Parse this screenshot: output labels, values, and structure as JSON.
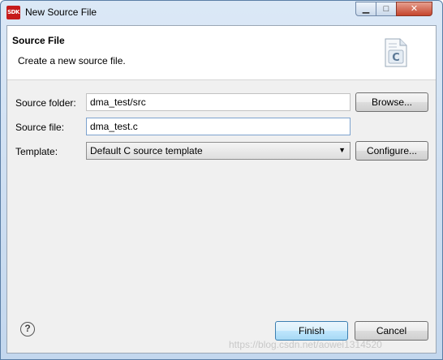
{
  "window": {
    "app_icon_text": "SDK",
    "title": "New Source File",
    "minimize_glyph": "▁",
    "maximize_glyph": "□",
    "close_glyph": "✕"
  },
  "banner": {
    "title": "Source File",
    "message": "Create a new source file.",
    "icon_letter": "C"
  },
  "form": {
    "source_folder_label": "Source folder:",
    "source_folder_value": "dma_test/src",
    "source_file_label": "Source file:",
    "source_file_value": "dma_test.c",
    "template_label": "Template:",
    "template_value": "Default C source template"
  },
  "buttons": {
    "browse": "Browse...",
    "configure": "Configure...",
    "finish": "Finish",
    "cancel": "Cancel",
    "help": "?"
  },
  "watermark": "https://blog.csdn.net/aowei1314520",
  "colors": {
    "title_bar": "#c3d7ee",
    "default_button": "#bee6fd",
    "app_icon": "#c61b1b"
  }
}
